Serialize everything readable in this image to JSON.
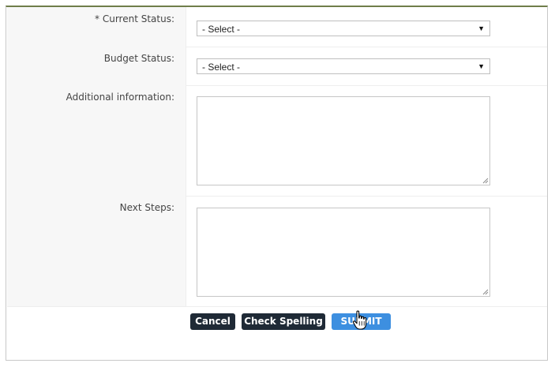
{
  "form": {
    "current_status": {
      "label": "* Current Status:",
      "value": "- Select -"
    },
    "budget_status": {
      "label": "Budget Status:",
      "value": "- Select -"
    },
    "additional_information": {
      "label": "Additional information:",
      "value": ""
    },
    "next_steps": {
      "label": "Next Steps:",
      "value": ""
    }
  },
  "actions": {
    "cancel_label": "Cancel",
    "spell_label": "Check Spelling",
    "submit_label": "SUBMIT"
  },
  "colors": {
    "frame_top_border": "#6f7d4a",
    "label_background": "#f7f7f7",
    "dark_button": "#1f2a36",
    "submit_button": "#3d8fe0"
  },
  "icons": {
    "select_caret": "dropdown-caret-icon",
    "textarea_grip": "resize-grip-icon",
    "pointer": "hand-pointer-cursor-icon"
  }
}
